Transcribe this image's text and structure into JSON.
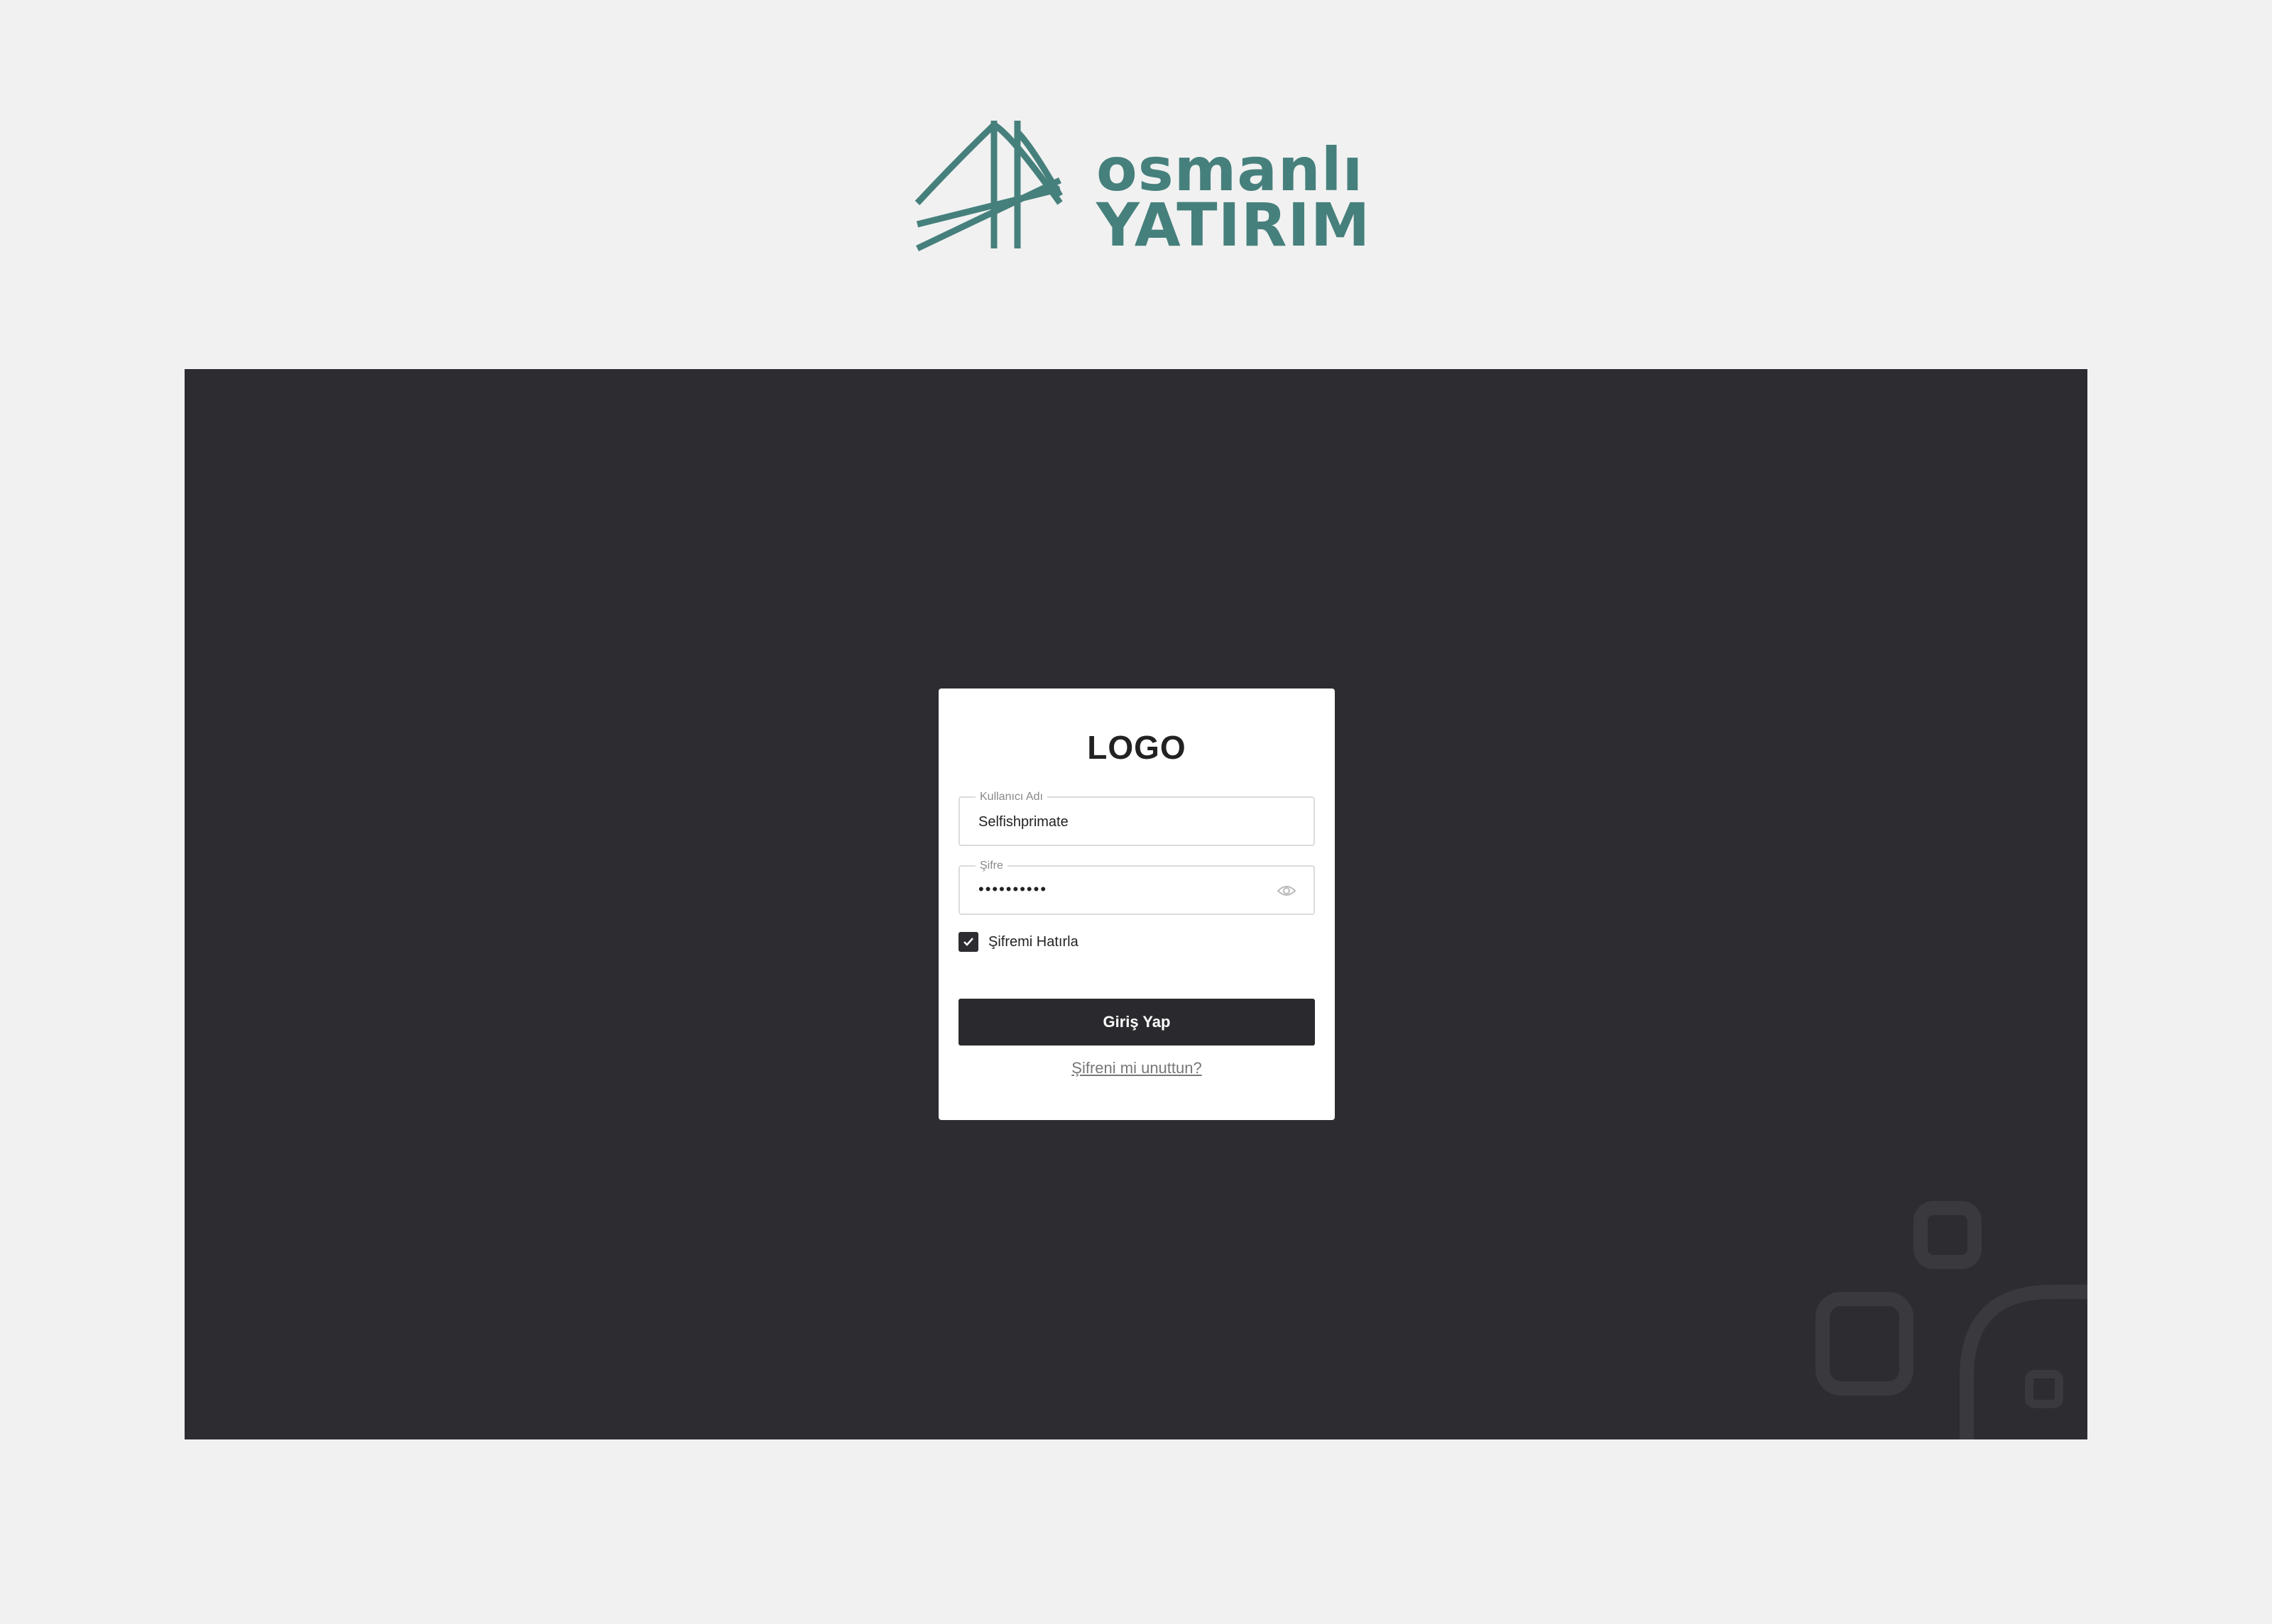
{
  "brand": {
    "line1": "osmanlı",
    "line2": "YATIRIM",
    "icon": "bridge-icon",
    "color": "#46807c"
  },
  "login": {
    "logo_text": "LOGO",
    "username_label": "Kullanıcı Adı",
    "username_value": "Selfishprimate",
    "password_label": "Şifre",
    "password_value": "••••••••••",
    "remember_label": "Şifremi Hatırla",
    "remember_checked": true,
    "submit_label": "Giriş Yap",
    "forgot_label": "Şifreni mi unuttun?"
  },
  "colors": {
    "page_bg": "#f1f1f1",
    "stage_bg": "#2d2c31",
    "button_bg": "#2a2a2e",
    "card_bg": "#ffffff"
  }
}
